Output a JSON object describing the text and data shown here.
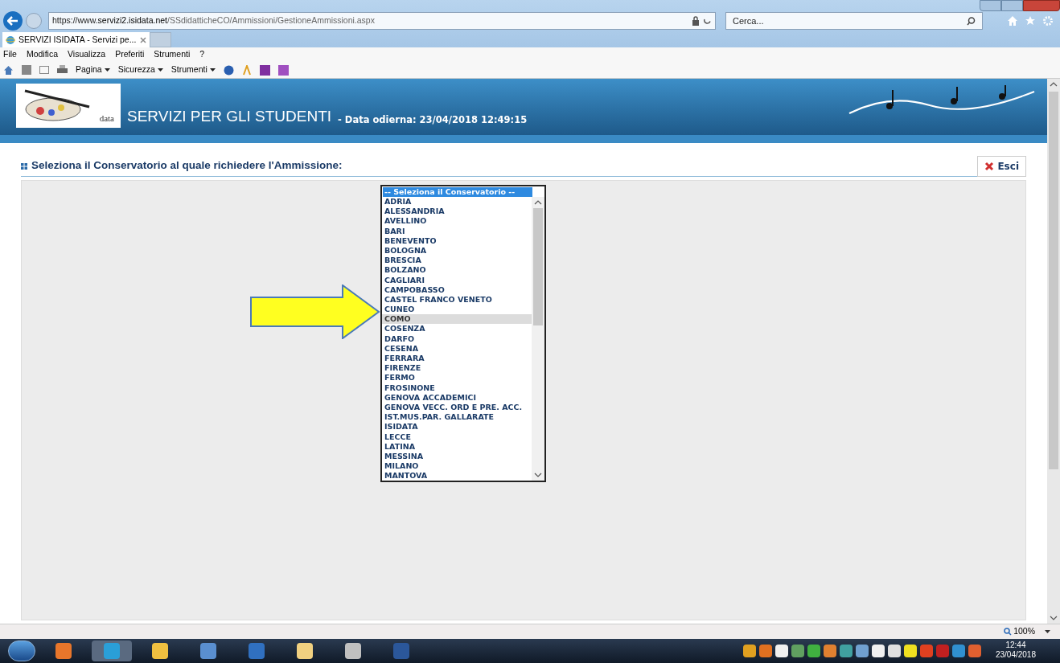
{
  "browser": {
    "url_scheme": "https://www.",
    "url_domain": "servizi2.isidata.net",
    "url_path": "/SSdidatticheCO/Ammissioni/GestioneAmmissioni.aspx",
    "search_placeholder": "Cerca...",
    "tabs": [
      {
        "label": "SERVIZI ISIDATA - Servizi pe...",
        "selected": true
      }
    ],
    "menu": [
      "File",
      "Modifica",
      "Visualizza",
      "Preferiti",
      "Strumenti",
      "?"
    ],
    "commands": [
      "Pagina",
      "Sicurezza",
      "Strumenti"
    ]
  },
  "header": {
    "title": "SERVIZI PER GLI STUDENTI",
    "date": "- Data odierna: 23/04/2018 12:49:15",
    "logo_text": "data"
  },
  "form": {
    "label": "Seleziona il Conservatorio al quale richiedere l'Ammissione:",
    "exit_button": "Esci",
    "dropdown": {
      "header": "-- Seleziona il Conservatorio --",
      "header_selected": true,
      "options": [
        {
          "label": "ADRIA",
          "highlighted": false
        },
        {
          "label": "ALESSANDRIA",
          "highlighted": false
        },
        {
          "label": "AVELLINO",
          "highlighted": false
        },
        {
          "label": "BARI",
          "highlighted": false
        },
        {
          "label": "BENEVENTO",
          "highlighted": false
        },
        {
          "label": "BOLOGNA",
          "highlighted": false
        },
        {
          "label": "BRESCIA",
          "highlighted": false
        },
        {
          "label": "BOLZANO",
          "highlighted": false
        },
        {
          "label": "CAGLIARI",
          "highlighted": false
        },
        {
          "label": "CAMPOBASSO",
          "highlighted": false
        },
        {
          "label": "CASTEL FRANCO VENETO",
          "highlighted": false
        },
        {
          "label": "CUNEO",
          "highlighted": false
        },
        {
          "label": "COMO",
          "highlighted": true
        },
        {
          "label": "COSENZA",
          "highlighted": false
        },
        {
          "label": "DARFO",
          "highlighted": false
        },
        {
          "label": "CESENA",
          "highlighted": false
        },
        {
          "label": "FERRARA",
          "highlighted": false
        },
        {
          "label": "FIRENZE",
          "highlighted": false
        },
        {
          "label": "FERMO",
          "highlighted": false
        },
        {
          "label": "FROSINONE",
          "highlighted": false
        },
        {
          "label": "GENOVA ACCADEMICI",
          "highlighted": false
        },
        {
          "label": "GENOVA VECC. ORD E PRE. ACC.",
          "highlighted": false
        },
        {
          "label": "IST.MUS.PAR. GALLARATE",
          "highlighted": false
        },
        {
          "label": "ISIDATA",
          "highlighted": false
        },
        {
          "label": "LECCE",
          "highlighted": false
        },
        {
          "label": "LATINA",
          "highlighted": false
        },
        {
          "label": "MESSINA",
          "highlighted": false
        },
        {
          "label": "MILANO",
          "highlighted": false
        },
        {
          "label": "MANTOVA",
          "highlighted": false
        }
      ]
    }
  },
  "status_bar": {
    "zoom": "100%"
  },
  "taskbar": {
    "time": "12:44",
    "date": "23/04/2018"
  }
}
